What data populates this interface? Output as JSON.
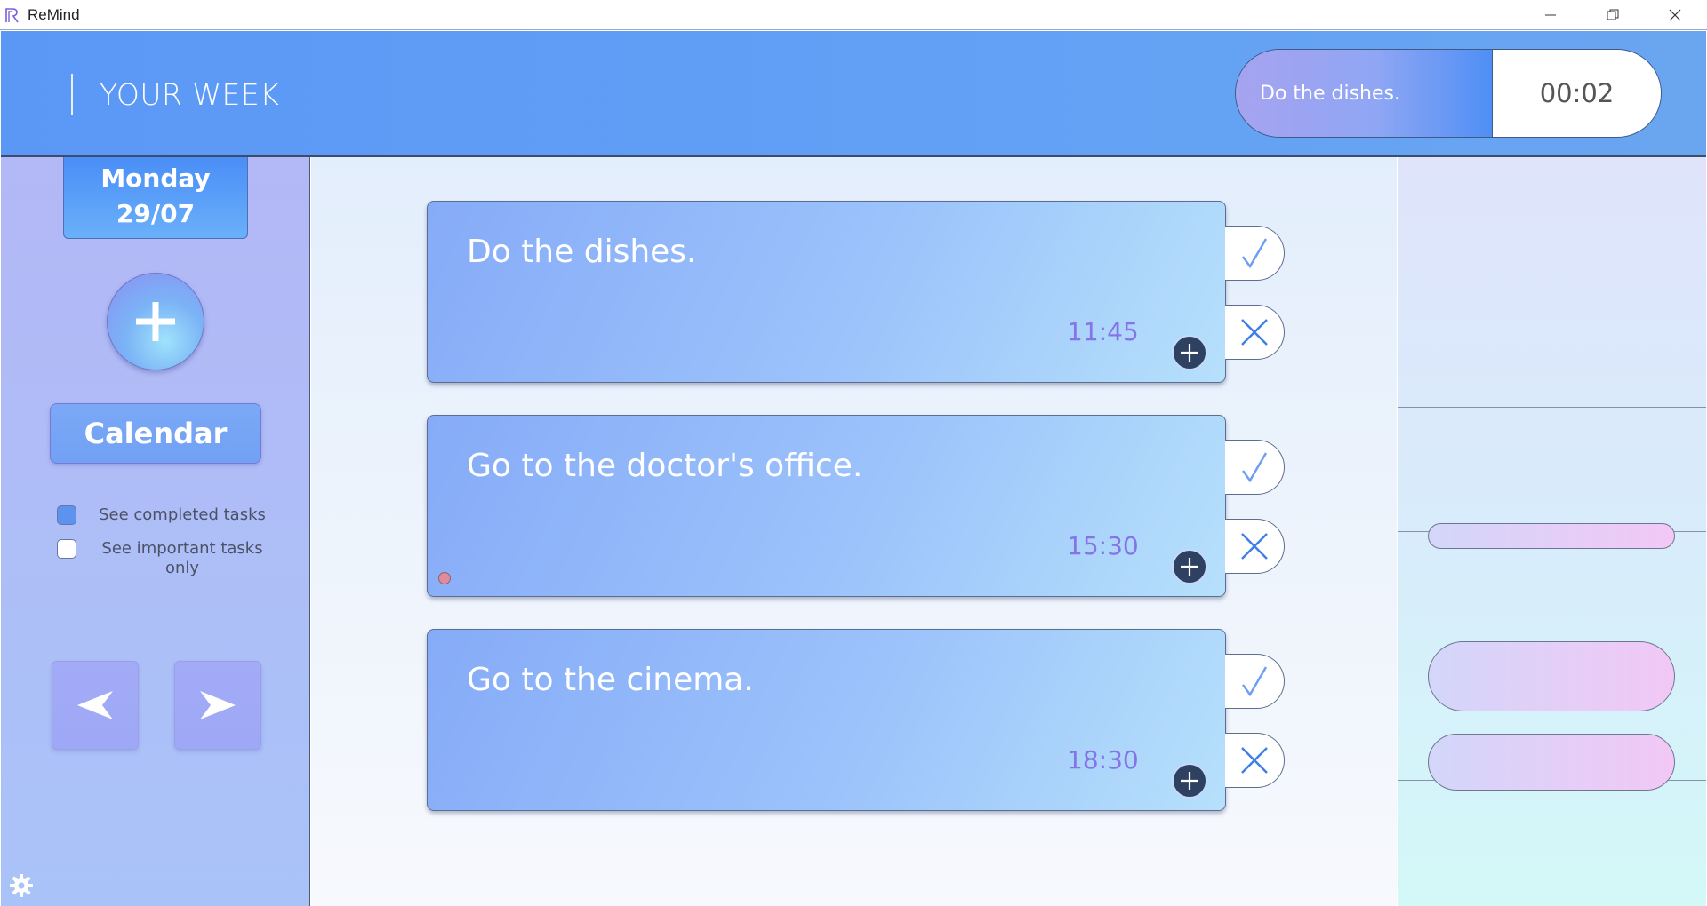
{
  "window": {
    "title": "ReMind",
    "minimize_label": "—",
    "maximize_label": "❐",
    "close_label": "✕"
  },
  "header": {
    "title": "YOUR WEEK",
    "current_task": "Do the dishes.",
    "timer": "00:02",
    "color": "#5b98f6"
  },
  "sidebar": {
    "day_name": "Monday",
    "day_date": "29/07",
    "calendar_label": "Calendar",
    "filters": [
      {
        "label": "See completed tasks",
        "checked": true
      },
      {
        "label": "See important tasks only",
        "checked": false
      }
    ],
    "prev_icon": "arrow-left-icon",
    "next_icon": "arrow-right-icon",
    "settings_icon": "gear-icon"
  },
  "tasks": [
    {
      "title": "Do the dishes.",
      "time": "11:45",
      "important": false
    },
    {
      "title": "Go to the doctor's office.",
      "time": "15:30",
      "important": true
    },
    {
      "title": "Go to the cinema.",
      "time": "18:30",
      "important": false
    }
  ],
  "colors": {
    "accent": "#5b98f6",
    "time_text": "#8574e8",
    "check": "#6e9ef4",
    "cross": "#3f7fe6"
  }
}
